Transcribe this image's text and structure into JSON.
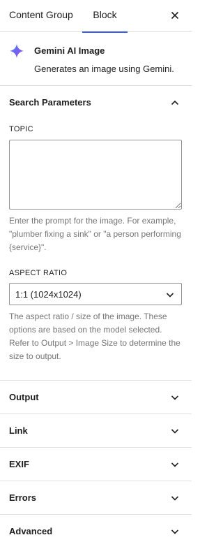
{
  "tabs": {
    "content_group": "Content Group",
    "block": "Block"
  },
  "block_card": {
    "title": "Gemini AI Image",
    "description": "Generates an image using Gemini.",
    "icon": "sparkle-icon"
  },
  "search_parameters": {
    "title": "Search Parameters",
    "expanded": true,
    "topic": {
      "label": "TOPIC",
      "value": "",
      "help": "Enter the prompt for the image. For example, \"plumber fixing a sink\" or \"a person performing {service}\"."
    },
    "aspect_ratio": {
      "label": "ASPECT RATIO",
      "selected": "1:1 (1024x1024)",
      "help": "The aspect ratio / size of the image. These options are based on the model selected. Refer to Output > Image Size to determine the size to output."
    }
  },
  "panels": [
    {
      "title": "Output"
    },
    {
      "title": "Link"
    },
    {
      "title": "EXIF"
    },
    {
      "title": "Errors"
    },
    {
      "title": "Advanced"
    }
  ],
  "colors": {
    "accent": "#3858e9",
    "text": "#1e1e1e",
    "muted": "#757575",
    "border": "#e0e0e0",
    "icon_gradient_start": "#4285f4",
    "icon_gradient_end": "#a142f4"
  }
}
